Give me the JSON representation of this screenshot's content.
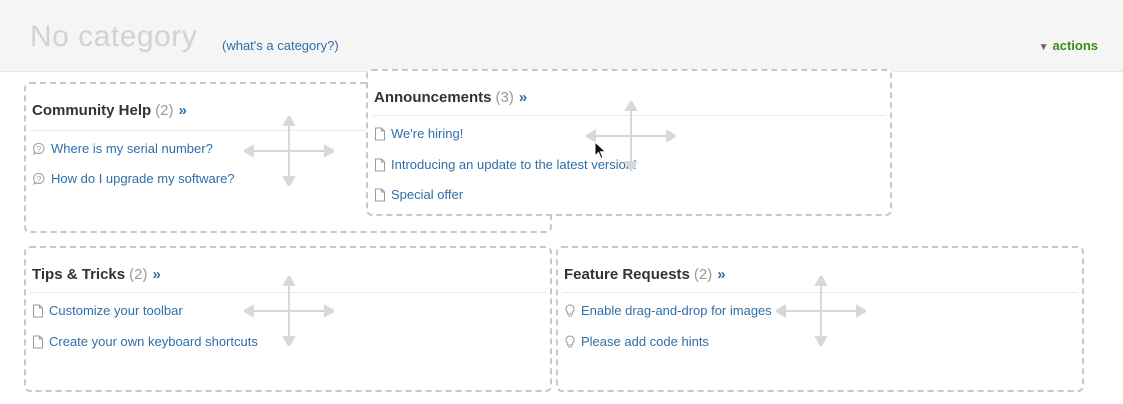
{
  "category": {
    "title": "No category",
    "help_link": "(what's a category?)",
    "actions_label": "actions"
  },
  "sections": [
    {
      "name": "Community Help",
      "count": "(2)",
      "more": "»",
      "items": [
        {
          "label": "Where is my serial number?",
          "icon": "question-bubble-icon"
        },
        {
          "label": "How do I upgrade my software?",
          "icon": "question-bubble-icon"
        }
      ]
    },
    {
      "name": "Announcements",
      "count": "(3)",
      "more": "»",
      "items": [
        {
          "label": "We're hiring!",
          "icon": "document-icon"
        },
        {
          "label": "Introducing an update to the latest version!",
          "icon": "document-icon"
        },
        {
          "label": "Special offer",
          "icon": "document-icon"
        }
      ]
    },
    {
      "name": "Tips & Tricks",
      "count": "(2)",
      "more": "»",
      "items": [
        {
          "label": "Customize your toolbar",
          "icon": "document-icon"
        },
        {
          "label": "Create your own keyboard shortcuts",
          "icon": "document-icon"
        }
      ]
    },
    {
      "name": "Feature Requests",
      "count": "(2)",
      "more": "»",
      "items": [
        {
          "label": "Enable drag-and-drop for images",
          "icon": "lightbulb-icon"
        },
        {
          "label": "Please add code hints",
          "icon": "lightbulb-icon"
        }
      ]
    }
  ],
  "colors": {
    "link": "#2f6fa8",
    "actions": "#3b8c17",
    "title": "#d2d2d2",
    "dashed_border": "#c8c8c8"
  }
}
